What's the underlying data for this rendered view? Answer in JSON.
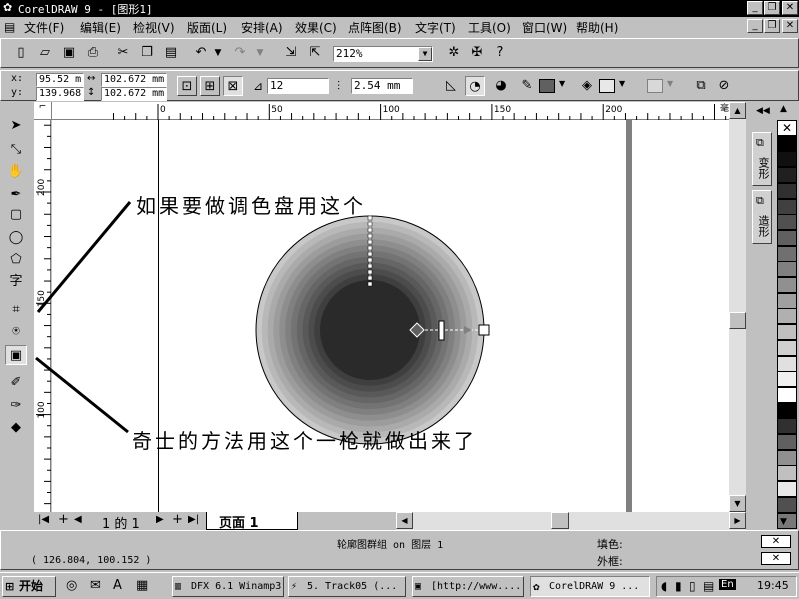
{
  "window": {
    "title": "CorelDRAW 9 - [图形1]"
  },
  "menu": [
    {
      "label": "文件(F)"
    },
    {
      "label": "编辑(E)"
    },
    {
      "label": "检视(V)"
    },
    {
      "label": "版面(L)"
    },
    {
      "label": "安排(A)"
    },
    {
      "label": "效果(C)"
    },
    {
      "label": "点阵图(B)"
    },
    {
      "label": "文字(T)"
    },
    {
      "label": "工具(O)"
    },
    {
      "label": "窗口(W)"
    },
    {
      "label": "帮助(H)"
    }
  ],
  "standard_toolbar": {
    "zoom": "212%"
  },
  "property_bar": {
    "x_label": "x:",
    "y_label": "y:",
    "x": "95.52 m",
    "y": "139.968",
    "width": "102.672 mm",
    "height": "102.672 mm",
    "steps": "12",
    "offset": "2.54 mm"
  },
  "ruler": {
    "h_ticks": [
      "0",
      "50",
      "100",
      "150",
      "200"
    ],
    "h_unit": "毫米",
    "v_ticks": [
      "200",
      "150",
      "100",
      "50"
    ]
  },
  "annotations": {
    "top": "如果要做调色盘用这个",
    "bottom": "奇士的方法用这个一枪就做出来了"
  },
  "page_nav": {
    "position": "1 的 1",
    "page_tab": "页面 1"
  },
  "dockers": {
    "tab1": "变形",
    "tab2": "造形"
  },
  "status": {
    "coords": "( 126.804, 100.152 )",
    "selection": "轮廓图群组 on 图层 1",
    "fill_label": "填色:",
    "outline_label": "外框:"
  },
  "taskbar": {
    "start": "开始",
    "tasks": [
      "DFX 6.1 Winamp3",
      "5. Track05 (...",
      "[http://www....",
      "CorelDRAW 9 ..."
    ],
    "lang": "En",
    "clock": "19:45"
  },
  "colors": {
    "accent": "#000000",
    "canvas": "#ffffff",
    "chrome": "#c0c0c0"
  },
  "contour": {
    "outer_radius_mm": 51.336,
    "rings": [
      "#c8c8c8",
      "#b8b8b8",
      "#aaaaaa",
      "#9c9c9c",
      "#8e8e8e",
      "#808080",
      "#737373",
      "#666666",
      "#595959",
      "#4c4c4c",
      "#3f3f3f",
      "#2a2a2a"
    ]
  },
  "palette_colors": [
    "#ffffff",
    "#000000",
    "#101010",
    "#202020",
    "#303030",
    "#404040",
    "#505050",
    "#606060",
    "#707070",
    "#808080",
    "#909090",
    "#a0a0a0",
    "#b0b0b0",
    "#c0c0c0",
    "#d0d0d0",
    "#e0e0e0",
    "#f0f0f0",
    "#ffffff",
    "#000000",
    "#303030",
    "#606060",
    "#909090",
    "#c0c0c0",
    "#e8e8e8",
    "#505050",
    "#787878"
  ]
}
